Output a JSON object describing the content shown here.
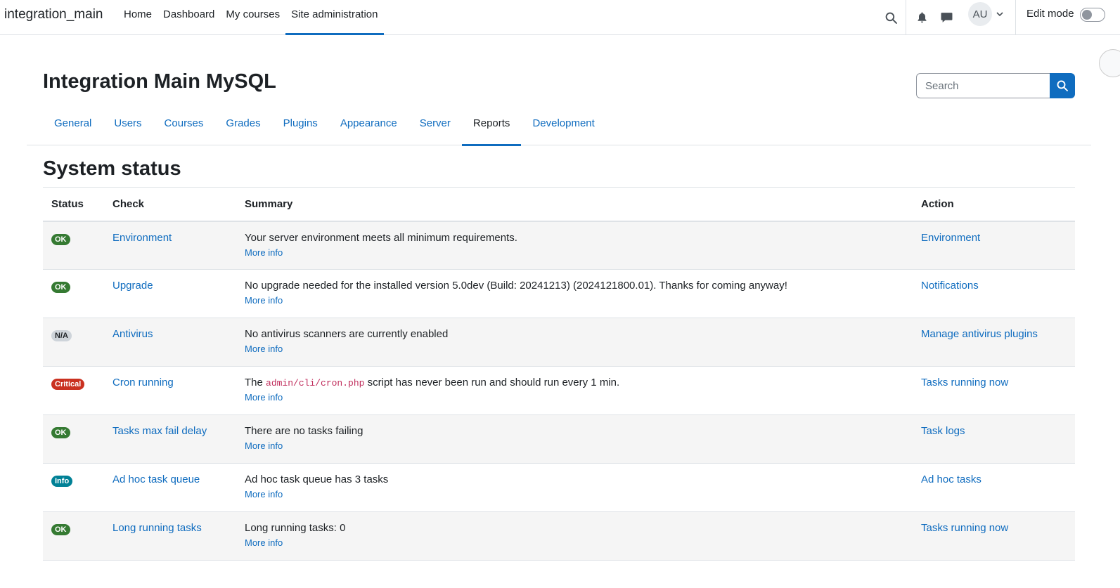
{
  "navbar": {
    "brand": "integration_main",
    "links": [
      "Home",
      "Dashboard",
      "My courses",
      "Site administration"
    ],
    "active_link": "Site administration",
    "avatar_initials": "AU",
    "edit_mode_label": "Edit mode"
  },
  "header": {
    "title": "Integration Main MySQL",
    "search_placeholder": "Search"
  },
  "subnav": {
    "tabs": [
      "General",
      "Users",
      "Courses",
      "Grades",
      "Plugins",
      "Appearance",
      "Server",
      "Reports",
      "Development"
    ],
    "active_tab": "Reports"
  },
  "section_title": "System status",
  "table": {
    "headers": {
      "status": "Status",
      "check": "Check",
      "summary": "Summary",
      "action": "Action"
    },
    "more_info_label": "More info",
    "rows": [
      {
        "status": "OK",
        "status_type": "ok",
        "check": "Environment",
        "summary": "Your server environment meets all minimum requirements.",
        "action": "Environment"
      },
      {
        "status": "OK",
        "status_type": "ok",
        "check": "Upgrade",
        "summary": "No upgrade needed for the installed version 5.0dev (Build: 20241213) (2024121800.01). Thanks for coming anyway!",
        "action": "Notifications"
      },
      {
        "status": "N/A",
        "status_type": "na",
        "check": "Antivirus",
        "summary": "No antivirus scanners are currently enabled",
        "action": "Manage antivirus plugins"
      },
      {
        "status": "Critical",
        "status_type": "critical",
        "check": "Cron running",
        "summary_prefix": "The ",
        "summary_code": "admin/cli/cron.php",
        "summary_suffix": " script has never been run and should run every 1 min.",
        "action": "Tasks running now"
      },
      {
        "status": "OK",
        "status_type": "ok",
        "check": "Tasks max fail delay",
        "summary": "There are no tasks failing",
        "action": "Task logs"
      },
      {
        "status": "Info",
        "status_type": "info",
        "check": "Ad hoc task queue",
        "summary": "Ad hoc task queue has 3 tasks",
        "action": "Ad hoc tasks"
      },
      {
        "status": "OK",
        "status_type": "ok",
        "check": "Long running tasks",
        "summary": "Long running tasks: 0",
        "action": "Tasks running now"
      }
    ]
  },
  "colors": {
    "primary": "#0f6cbf",
    "ok": "#357a32",
    "critical": "#ca3120",
    "info": "#008196",
    "na": "#ced4da"
  },
  "icons": [
    "search-icon",
    "bell-icon",
    "chat-icon",
    "chevron-down-icon"
  ]
}
